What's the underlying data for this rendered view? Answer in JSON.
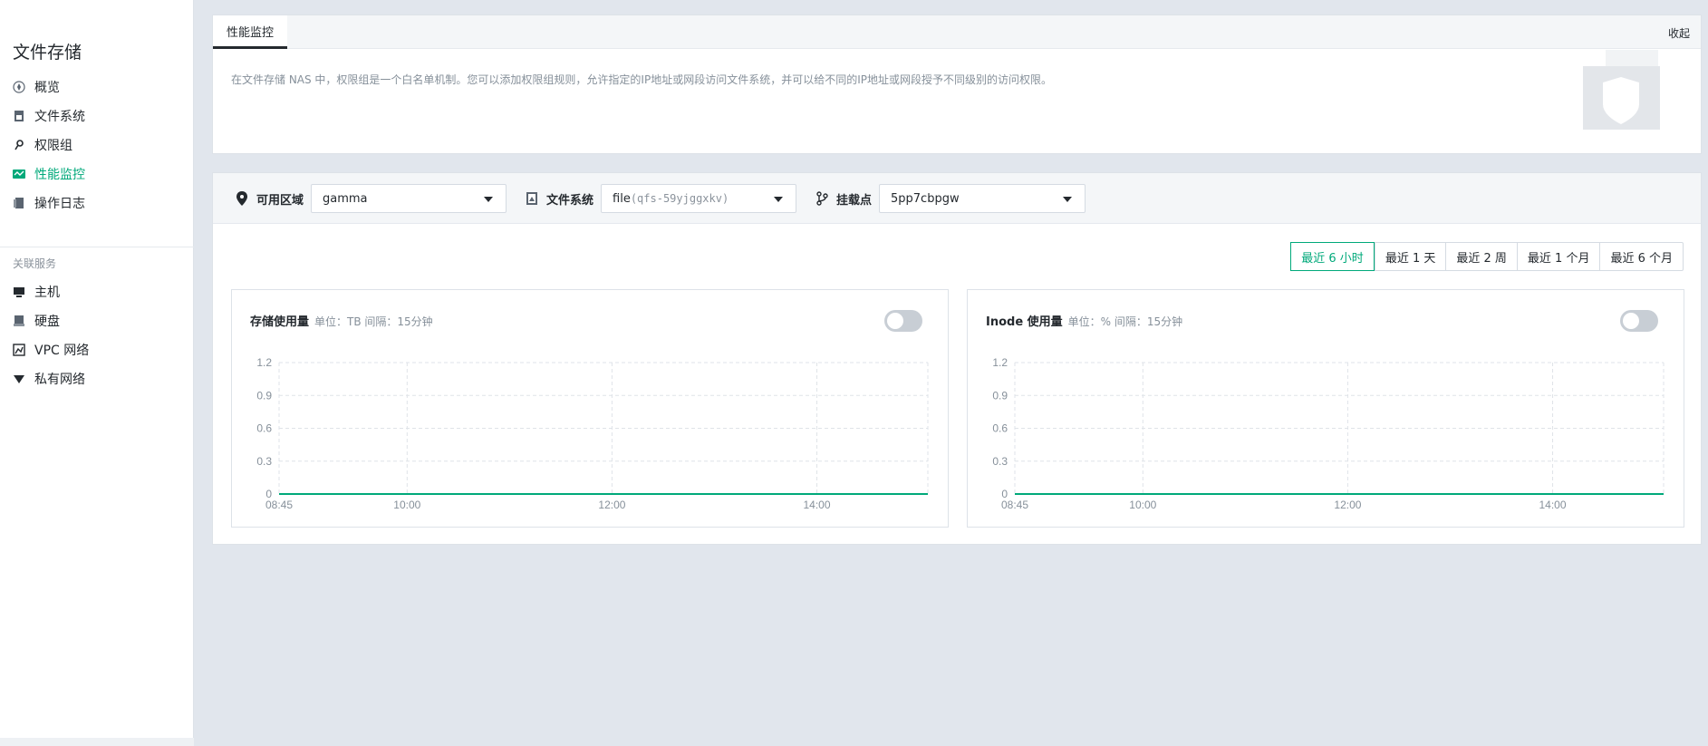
{
  "sidebar": {
    "title": "文件存储",
    "items": [
      {
        "label": "概览",
        "icon": "overview-icon"
      },
      {
        "label": "文件系统",
        "icon": "file-system-icon"
      },
      {
        "label": "权限组",
        "icon": "key-icon"
      },
      {
        "label": "性能监控",
        "icon": "monitor-icon",
        "active": true
      },
      {
        "label": "操作日志",
        "icon": "log-icon"
      }
    ],
    "related_title": "关联服务",
    "related": [
      {
        "label": "主机",
        "icon": "host-icon"
      },
      {
        "label": "硬盘",
        "icon": "disk-icon"
      },
      {
        "label": "VPC 网络",
        "icon": "vpc-icon"
      },
      {
        "label": "私有网络",
        "icon": "private-network-icon"
      }
    ]
  },
  "info": {
    "tab_label": "性能监控",
    "collapse_label": "收起",
    "description": "在文件存储 NAS 中，权限组是一个白名单机制。您可以添加权限组规则，允许指定的IP地址或网段访问文件系统，并可以给不同的IP地址或网段授予不同级别的访问权限。"
  },
  "filters": {
    "zone": {
      "label": "可用区域",
      "value": "gamma"
    },
    "filesystem": {
      "label": "文件系统",
      "value_prefix": "file",
      "value_id": "(qfs-59yjggxkv)"
    },
    "mount": {
      "label": "挂载点",
      "value": "5pp7cbpgw"
    }
  },
  "time_range": {
    "options": [
      "最近 6 小时",
      "最近 1 天",
      "最近 2 周",
      "最近 1 个月",
      "最近 6 个月"
    ],
    "selected": 0
  },
  "charts": [
    {
      "title": "存储使用量",
      "meta": "单位：TB 间隔：15分钟",
      "toggle_on": false
    },
    {
      "title": "Inode 使用量",
      "meta": "单位：% 间隔：15分钟",
      "toggle_on": false
    }
  ],
  "chart_data": [
    {
      "type": "line",
      "title": "存储使用量",
      "ylim": [
        0,
        1.2
      ],
      "yticks": [
        "0",
        "0.3",
        "0.6",
        "0.9",
        "1.2"
      ],
      "xticks": [
        "08:45",
        "10:00",
        "12:00",
        "14:00"
      ],
      "series": [
        {
          "values": [
            0,
            0,
            0,
            0,
            0
          ]
        }
      ],
      "line_color": "#00a97a",
      "grid": true
    },
    {
      "type": "line",
      "title": "Inode 使用量",
      "ylim": [
        0,
        1.2
      ],
      "yticks": [
        "0",
        "0.3",
        "0.6",
        "0.9",
        "1.2"
      ],
      "xticks": [
        "08:45",
        "10:00",
        "12:00",
        "14:00"
      ],
      "series": [
        {
          "values": [
            0,
            0,
            0,
            0,
            0
          ]
        }
      ],
      "line_color": "#00a97a",
      "grid": true
    }
  ]
}
